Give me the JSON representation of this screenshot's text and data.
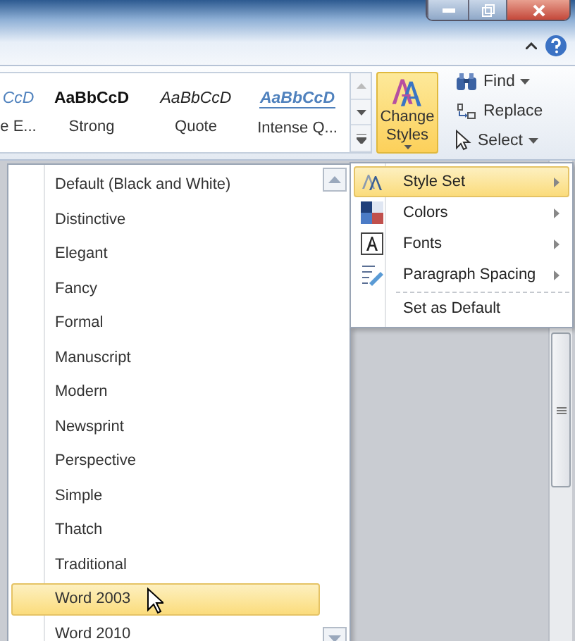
{
  "ribbon": {
    "gallery": [
      {
        "preview": "CcD",
        "label": "e E...",
        "kind": "emphasis"
      },
      {
        "preview": "AaBbCcD",
        "label": "Strong",
        "kind": "strong"
      },
      {
        "preview": "AaBbCcD",
        "label": "Quote",
        "kind": "quote"
      },
      {
        "preview": "AaBbCcD",
        "label": "Intense Q...",
        "kind": "intense"
      }
    ],
    "change_styles": {
      "label": "Change Styles",
      "active": true
    },
    "editing": [
      {
        "label": "Find",
        "kind": "find",
        "dropdown": true
      },
      {
        "label": "Replace",
        "kind": "replace",
        "dropdown": false
      },
      {
        "label": "Select",
        "kind": "select",
        "dropdown": true
      }
    ]
  },
  "style_sets": [
    {
      "label": "Default (Black and White)",
      "selected": false
    },
    {
      "label": "Distinctive",
      "selected": false
    },
    {
      "label": "Elegant",
      "selected": false
    },
    {
      "label": "Fancy",
      "selected": false
    },
    {
      "label": "Formal",
      "selected": false
    },
    {
      "label": "Manuscript",
      "selected": false
    },
    {
      "label": "Modern",
      "selected": false
    },
    {
      "label": "Newsprint",
      "selected": false
    },
    {
      "label": "Perspective",
      "selected": false
    },
    {
      "label": "Simple",
      "selected": false
    },
    {
      "label": "Thatch",
      "selected": false
    },
    {
      "label": "Traditional",
      "selected": false
    },
    {
      "label": "Word 2003",
      "selected": true
    },
    {
      "label": "Word 2010",
      "selected": false
    }
  ],
  "menu": [
    {
      "label": "Style Set",
      "kind": "styleset",
      "submenu": true,
      "selected": true
    },
    {
      "label": "Colors",
      "kind": "colors",
      "submenu": true,
      "selected": false
    },
    {
      "label": "Fonts",
      "kind": "fonts",
      "submenu": true,
      "selected": false
    },
    {
      "label": "Paragraph Spacing",
      "kind": "spacing",
      "submenu": true,
      "selected": false
    },
    {
      "label": "Set as Default",
      "kind": "default",
      "submenu": false,
      "selected": false
    }
  ]
}
